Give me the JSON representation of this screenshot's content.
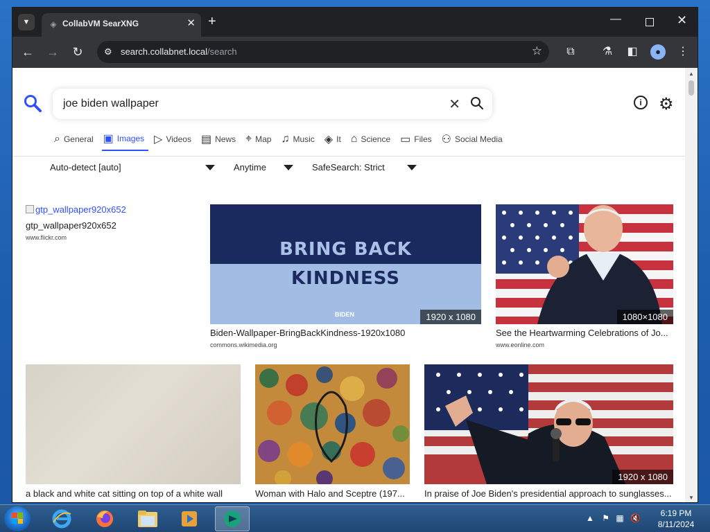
{
  "browser": {
    "tab_title": "CollabVM SearXNG",
    "url_host": "search.collabnet.local",
    "url_path": "/search"
  },
  "search": {
    "query": "joe biden wallpaper"
  },
  "categories": [
    {
      "label": "General",
      "icon": "search-icon"
    },
    {
      "label": "Images",
      "icon": "image-icon"
    },
    {
      "label": "Videos",
      "icon": "play-icon"
    },
    {
      "label": "News",
      "icon": "newspaper-icon"
    },
    {
      "label": "Map",
      "icon": "map-pin-icon"
    },
    {
      "label": "Music",
      "icon": "music-note-icon"
    },
    {
      "label": "It",
      "icon": "layers-icon"
    },
    {
      "label": "Science",
      "icon": "graduation-cap-icon"
    },
    {
      "label": "Files",
      "icon": "files-icon"
    },
    {
      "label": "Social Media",
      "icon": "people-icon"
    }
  ],
  "active_category": "Images",
  "filters": {
    "language": "Auto-detect [auto]",
    "time": "Anytime",
    "safesearch": "SafeSearch: Strict"
  },
  "results": [
    {
      "broken_alt": "gtp_wallpaper920x652",
      "title": "gtp_wallpaper920x652",
      "source": "www.flickr.com"
    },
    {
      "image_text_line1": "BRING BACK",
      "image_text_line2": "KINDNESS",
      "image_logo": "BIDEN",
      "resolution": "1920 x 1080",
      "title": "Biden-Wallpaper-BringBackKindness-1920x1080",
      "source": "commons.wikimedia.org"
    },
    {
      "resolution": "1080×1080",
      "title": "See the Heartwarming Celebrations of Jo...",
      "source": "www.eonline.com"
    },
    {
      "title": "a black and white cat sitting on top of a white wall"
    },
    {
      "title": "Woman with Halo and Sceptre (197..."
    },
    {
      "resolution": "1920 x 1080",
      "title": "In praise of Joe Biden's presidential approach to sunglasses..."
    }
  ],
  "taskbar": {
    "time": "6:19 PM",
    "date": "8/11/2024"
  },
  "colors": {
    "accent": "#3050ff",
    "chrome_dark": "#202124",
    "chrome_toolbar": "#35363a"
  }
}
